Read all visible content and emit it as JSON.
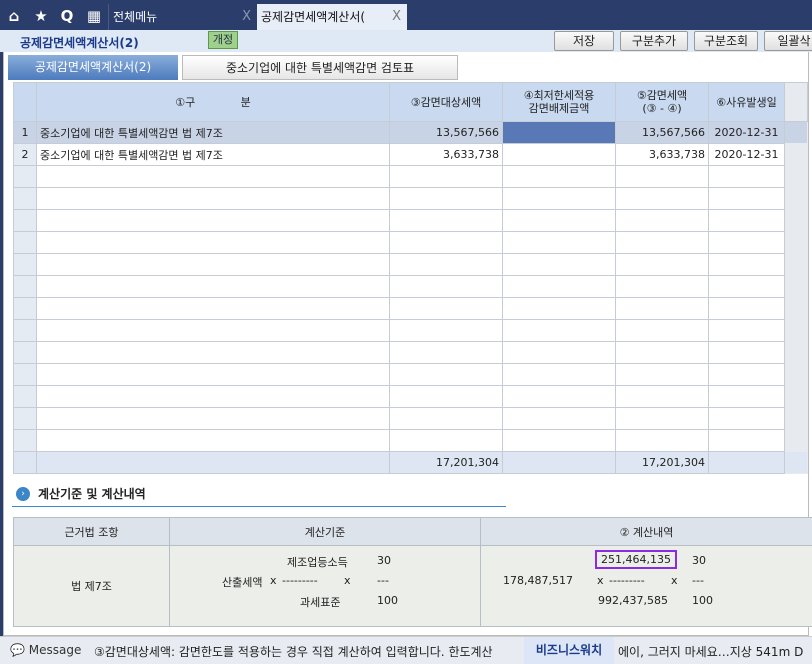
{
  "tabs": {
    "menu": "전체메뉴",
    "active": "공제감면세액계산서(",
    "close": "X"
  },
  "header": {
    "title": "공제감면세액계산서(2)",
    "badge": "개정",
    "buttons": [
      "저장",
      "구분추가",
      "구분조회",
      "일괄삭"
    ]
  },
  "subtabs": [
    "공제감면세액계산서(2)",
    "중소기업에 대한 특별세액감면 검토표"
  ],
  "grid": {
    "columns": [
      "",
      "①구             분",
      "③감면대상세액",
      "④최저한세적용\n감면배제금액",
      "⑤감면세액\n(③ - ④)",
      "⑥사유발생일"
    ],
    "rows": [
      {
        "no": "1",
        "name": "중소기업에 대한 특별세액감면 법 제7조",
        "target": "13,567,566",
        "excluded": "",
        "reduction": "13,567,566",
        "date": "2020-12-31"
      },
      {
        "no": "2",
        "name": "중소기업에 대한 특별세액감면 법 제7조",
        "target": "3,633,738",
        "excluded": "",
        "reduction": "3,633,738",
        "date": "2020-12-31"
      }
    ],
    "total": {
      "target": "17,201,304",
      "reduction": "17,201,304"
    }
  },
  "section": {
    "title": "계산기준 및 계산내역"
  },
  "calc": {
    "headers": [
      "근거법 조항",
      "계산기준",
      "② 계산내역"
    ],
    "law": "법 제7조",
    "basis": {
      "top": "제조업등소득",
      "left": "산출세액",
      "bottom": "과세표준",
      "x": "x",
      "dash": "---------",
      "rtop": "30",
      "rmid": "---",
      "rbot": "100"
    },
    "detail": {
      "top": "251,464,135",
      "left": "178,487,517",
      "bottom": "992,437,585",
      "x": "x",
      "dash": "---------",
      "rtop": "30",
      "rmid": "---",
      "rbot": "100"
    }
  },
  "status": {
    "message_label": "Message",
    "message": "③감면대상세액: 감면한도를 적용하는 경우 직접 계산하여 입력합니다. 한도계산",
    "biz": "비즈니스워치",
    "news": "에이, 그러지 마세요…지상 541m D"
  }
}
